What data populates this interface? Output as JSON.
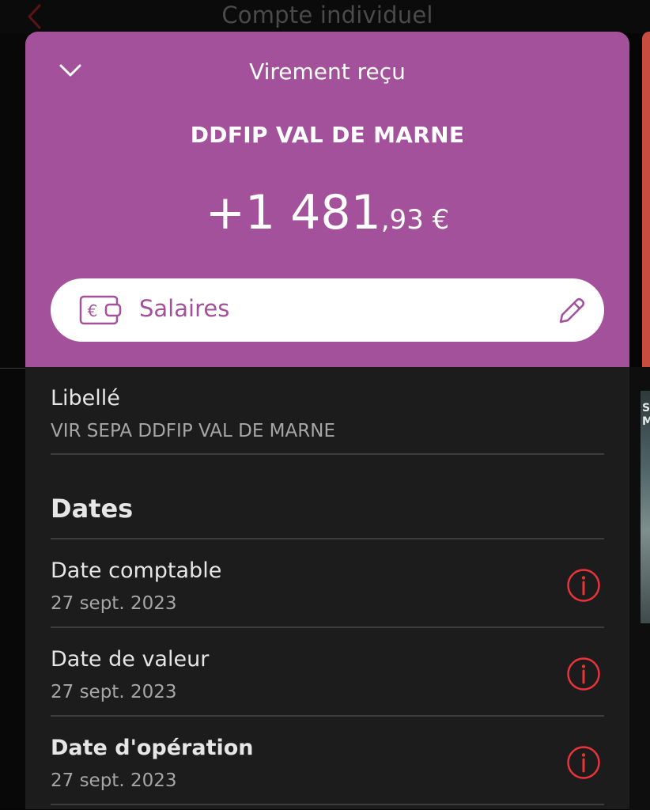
{
  "background": {
    "title": "Compte individuel",
    "back_icon": "chevron-left-icon"
  },
  "sheet": {
    "close_icon": "chevron-down-icon",
    "title": "Virement reçu",
    "merchant": "DDFIP VAL DE MARNE",
    "amount": {
      "integer": "+1 481",
      "decimal": ",93",
      "currency": " €"
    },
    "header_color": "#a3519a",
    "category": {
      "icon": "wallet-euro-icon",
      "label": "Salaires",
      "edit_icon": "pencil-icon"
    }
  },
  "details": {
    "libelle": {
      "label": "Libellé",
      "value": "VIR SEPA DDFIP VAL DE MARNE"
    },
    "dates_title": "Dates",
    "dates": [
      {
        "label": "Date comptable",
        "value": "27 sept. 2023",
        "info_icon": "info-circle-icon"
      },
      {
        "label": "Date de valeur",
        "value": "27 sept. 2023",
        "info_icon": "info-circle-icon"
      },
      {
        "label": "Date d'opération",
        "value": "27 sept. 2023",
        "info_icon": "info-circle-icon"
      }
    ],
    "accent_color": "#e8343a"
  }
}
